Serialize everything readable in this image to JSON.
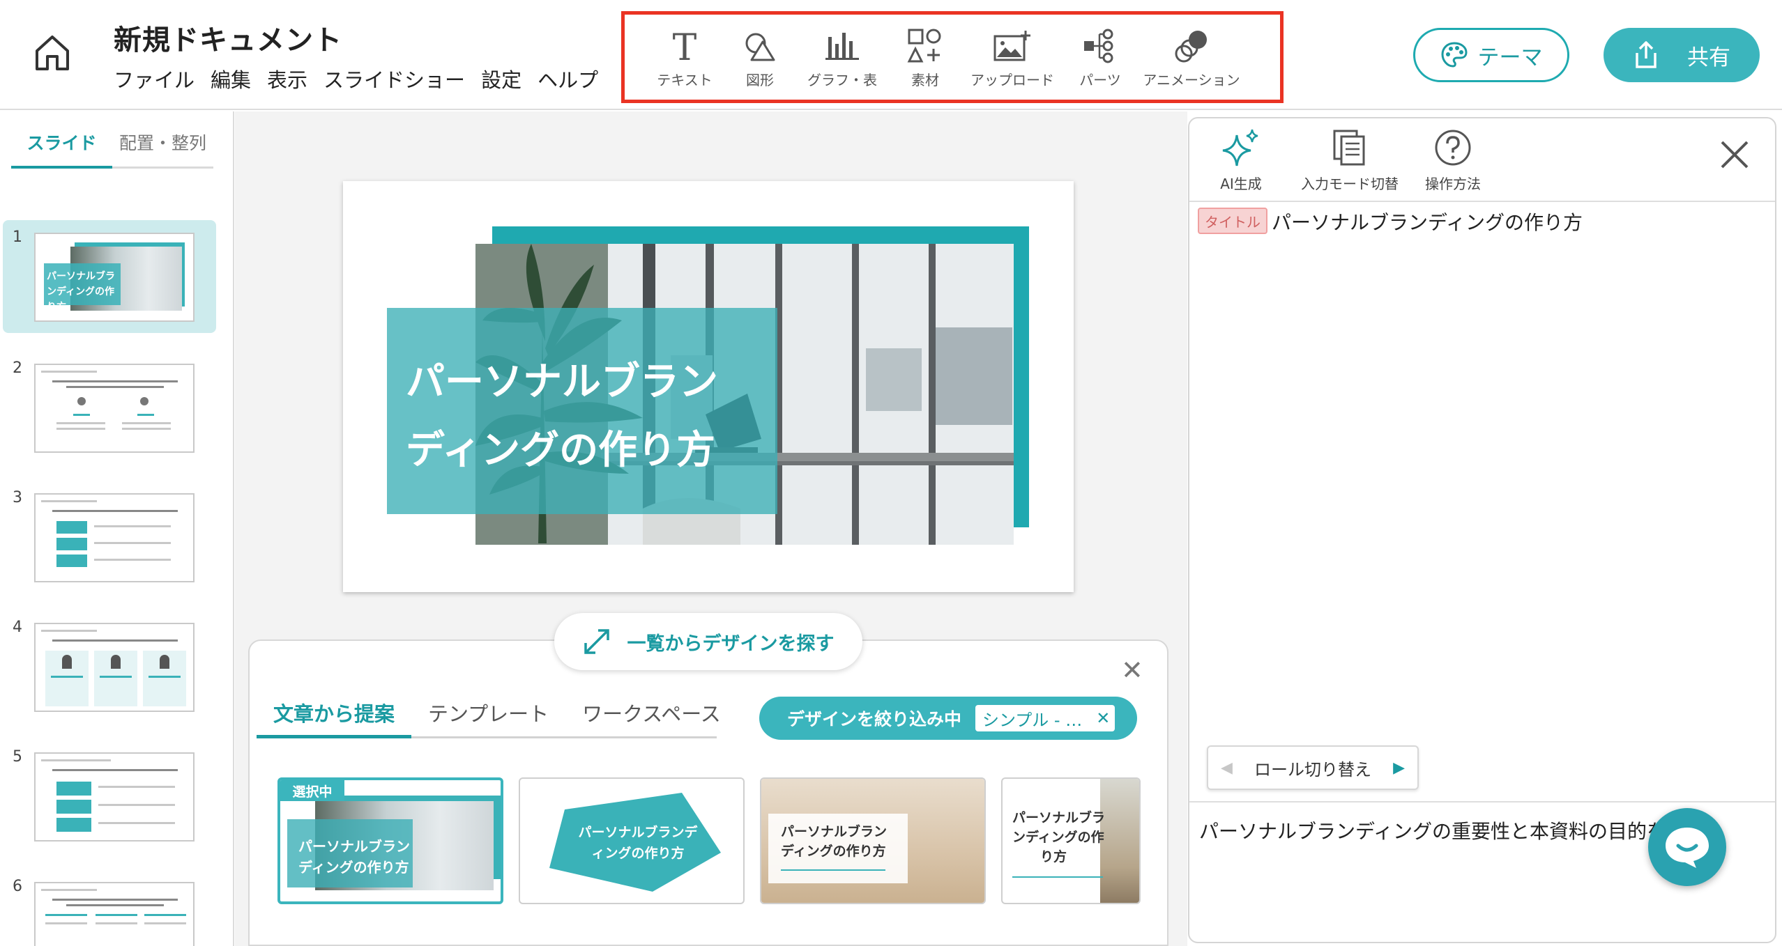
{
  "app": {
    "doc_title": "新規ドキュメント",
    "menu": [
      "ファイル",
      "編集",
      "表示",
      "スライドショー",
      "設定",
      "ヘルプ"
    ]
  },
  "toolbar": {
    "items": [
      {
        "label": "テキスト",
        "icon": "text-icon"
      },
      {
        "label": "図形",
        "icon": "shape-icon"
      },
      {
        "label": "グラフ・表",
        "icon": "chart-icon"
      },
      {
        "label": "素材",
        "icon": "assets-icon"
      },
      {
        "label": "アップロード",
        "icon": "upload-image-icon"
      },
      {
        "label": "パーツ",
        "icon": "parts-icon"
      },
      {
        "label": "アニメーション",
        "icon": "animation-icon"
      }
    ]
  },
  "header_buttons": {
    "theme": "テーマ",
    "share": "共有"
  },
  "left_panel": {
    "tabs": [
      "スライド",
      "配置・整列"
    ],
    "active_tab": 0,
    "slides": [
      {
        "num": "1",
        "title": "パーソナルブランディングの作り方"
      },
      {
        "num": "2"
      },
      {
        "num": "3"
      },
      {
        "num": "4"
      },
      {
        "num": "5"
      },
      {
        "num": "6"
      }
    ],
    "active_slide": 0
  },
  "slide": {
    "title_line1": "パーソナルブラン",
    "title_line2": "ディングの作り方"
  },
  "design_panel": {
    "browse_button": "一覧からデザインを探す",
    "tabs": [
      "文章から提案",
      "テンプレート",
      "ワークスペース"
    ],
    "active_tab": 0,
    "filter_label": "デザインを絞り込み中",
    "filter_tag": "シンプル - …",
    "selected_badge": "選択中",
    "cards": [
      {
        "line1": "パーソナルブラン",
        "line2": "ディングの作り方"
      },
      {
        "line1": "パーソナルブランデ",
        "line2": "ィングの作り方"
      },
      {
        "line1": "パーソナルブラン",
        "line2": "ディングの作り方"
      },
      {
        "line1": "パーソナルブラ",
        "line2": "ンディングの作",
        "line3": "り方"
      }
    ]
  },
  "right_panel": {
    "tools": [
      {
        "label": "AI生成",
        "icon": "sparkle-icon"
      },
      {
        "label": "入力モード切替",
        "icon": "copy-doc-icon"
      },
      {
        "label": "操作方法",
        "icon": "help-icon"
      }
    ],
    "title_tag": "タイトル",
    "title_text": "パーソナルブランディングの作り方",
    "role_switch": "ロール切り替え",
    "body_text": "パーソナルブランディングの重要性と本資料の目的を紹"
  },
  "colors": {
    "accent": "#3bb5bd",
    "accent_dark": "#1a9aa1",
    "highlight": "#ea3323"
  }
}
